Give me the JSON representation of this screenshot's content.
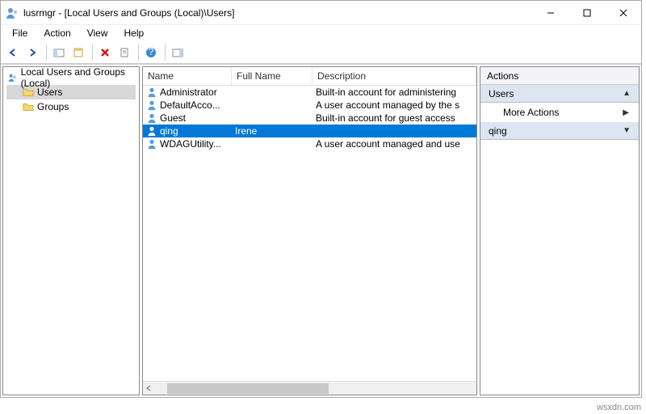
{
  "window": {
    "title": "lusrmgr - [Local Users and Groups (Local)\\Users]"
  },
  "menu": {
    "file": "File",
    "action": "Action",
    "view": "View",
    "help": "Help"
  },
  "tree": {
    "root": "Local Users and Groups (Local)",
    "users": "Users",
    "groups": "Groups"
  },
  "columns": {
    "name": "Name",
    "full_name": "Full Name",
    "description": "Description"
  },
  "users": [
    {
      "name": "Administrator",
      "full": "",
      "desc": "Built-in account for administering"
    },
    {
      "name": "DefaultAcco...",
      "full": "",
      "desc": "A user account managed by the s"
    },
    {
      "name": "Guest",
      "full": "",
      "desc": "Built-in account for guest access"
    },
    {
      "name": "qing",
      "full": "Irene",
      "desc": "",
      "selected": true
    },
    {
      "name": "WDAGUtility...",
      "full": "",
      "desc": "A user account managed and use"
    }
  ],
  "actions": {
    "header": "Actions",
    "section1": "Users",
    "more": "More Actions",
    "section2": "qing"
  },
  "watermark": "wsxdn.com"
}
